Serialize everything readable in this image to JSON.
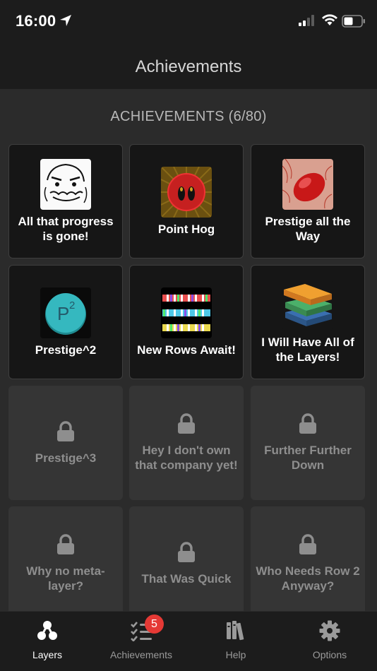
{
  "status_bar": {
    "time": "16:00"
  },
  "header": {
    "title": "Achievements"
  },
  "section": {
    "title": "ACHIEVEMENTS (6/80)"
  },
  "achievements": [
    {
      "label": "All that progress is gone!",
      "unlocked": true,
      "icon": "rage-face-icon"
    },
    {
      "label": "Point Hog",
      "unlocked": true,
      "icon": "pig-snout-icon"
    },
    {
      "label": "Prestige all the Way",
      "unlocked": true,
      "icon": "red-cell-icon"
    },
    {
      "label": "Prestige^2",
      "unlocked": true,
      "icon": "p-squared-icon"
    },
    {
      "label": "New Rows Await!",
      "unlocked": true,
      "icon": "rows-icon"
    },
    {
      "label": "I Will Have All of the Layers!",
      "unlocked": true,
      "icon": "layers-stack-icon"
    },
    {
      "label": "Prestige^3",
      "unlocked": false,
      "icon": "lock-icon"
    },
    {
      "label": "Hey I don't own that company yet!",
      "unlocked": false,
      "icon": "lock-icon"
    },
    {
      "label": "Further Further Down",
      "unlocked": false,
      "icon": "lock-icon"
    },
    {
      "label": "Why no meta-layer?",
      "unlocked": false,
      "icon": "lock-icon"
    },
    {
      "label": "That Was Quick",
      "unlocked": false,
      "icon": "lock-icon"
    },
    {
      "label": "Who Needs Row 2 Anyway?",
      "unlocked": false,
      "icon": "lock-icon"
    }
  ],
  "tabs": [
    {
      "label": "Layers",
      "icon": "layers-icon",
      "active": true
    },
    {
      "label": "Achievements",
      "icon": "checklist-icon",
      "badge": "5"
    },
    {
      "label": "Help",
      "icon": "books-icon"
    },
    {
      "label": "Options",
      "icon": "gear-icon"
    }
  ],
  "colors": {
    "tab_active": "#ffffff",
    "tab_inactive": "#9a9a9a",
    "badge": "#e53935"
  }
}
